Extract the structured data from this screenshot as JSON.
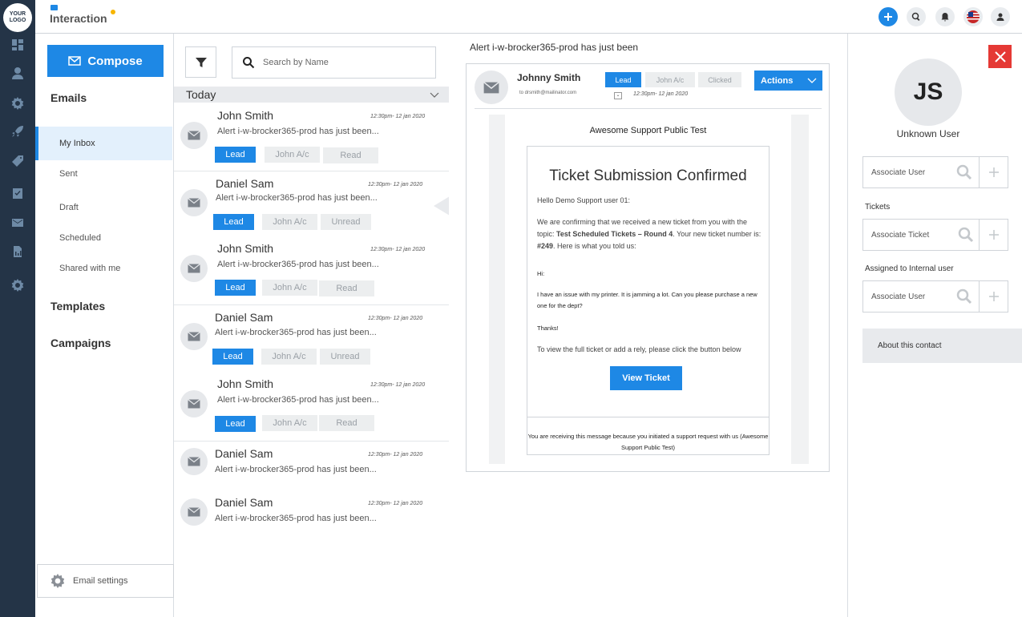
{
  "header": {
    "logo_text": "YOUR LOGO",
    "app_name": "Interaction",
    "icons": [
      "plus-icon",
      "search-icon",
      "bell-icon",
      "us-flag-icon",
      "user-icon"
    ]
  },
  "rail": {
    "icons": [
      "dashboard-icon",
      "contacts-icon",
      "settings-gear-icon",
      "rocket-icon",
      "tag-icon",
      "tasks-icon",
      "mail-icon",
      "reports-icon",
      "cog-icon"
    ]
  },
  "sidebar": {
    "compose_label": "Compose",
    "emails_title": "Emails",
    "folders": [
      {
        "label": "My Inbox"
      },
      {
        "label": "Sent"
      },
      {
        "label": "Draft"
      },
      {
        "label": "Scheduled"
      },
      {
        "label": "Shared with me"
      }
    ],
    "templates_title": "Templates",
    "campaigns_title": "Campaigns",
    "settings_label": "Email settings"
  },
  "list": {
    "search_placeholder": "Search by Name",
    "group_label": "Today",
    "messages": [
      {
        "name": "John Smith",
        "time": "12:30pm-   12 jan 2020",
        "subject": "Alert i-w-brocker365-prod has just been...",
        "tags": [
          "Lead",
          "John A/c",
          "Read"
        ]
      },
      {
        "name": "Daniel Sam",
        "time": "12:30pm-   12 jan 2020",
        "subject": "Alert i-w-brocker365-prod has just been...",
        "tags": [
          "Lead",
          "John A/c",
          "Unread"
        ]
      },
      {
        "name": "John Smith",
        "time": "12:30pm-   12 jan 2020",
        "subject": "Alert i-w-brocker365-prod has just been...",
        "tags": [
          "Lead",
          "John A/c",
          "Read"
        ]
      },
      {
        "name": "Daniel Sam",
        "time": "12:30pm-   12 jan 2020",
        "subject": "Alert i-w-brocker365-prod has just been...",
        "tags": [
          "Lead",
          "John A/c",
          "Unread"
        ]
      },
      {
        "name": "John Smith",
        "time": "12:30pm-   12 jan 2020",
        "subject": "Alert i-w-brocker365-prod has just been...",
        "tags": [
          "Lead",
          "John A/c",
          "Read"
        ]
      },
      {
        "name": "Daniel Sam",
        "time": "12:30pm-   12 jan 2020",
        "subject": "Alert i-w-brocker365-prod has just been..."
      },
      {
        "name": "Daniel Sam",
        "time": "12:30pm-   12 jan 2020",
        "subject": "Alert i-w-brocker365-prod has just been..."
      }
    ]
  },
  "reader": {
    "title": "Alert i-w-brocker365-prod has just been",
    "from_name": "Johnny Smith",
    "to": "to drsmith@mailinator.com",
    "time": "12:30pm-  12 jan 2020",
    "tags": [
      "Lead",
      "John A/c",
      "Clicked"
    ],
    "actions_label": "Actions",
    "email": {
      "brand": "Awesome Support Public Test",
      "heading": "Ticket Submission Confirmed",
      "greeting": "Hello Demo Support user 01:",
      "confirm_prefix": "We are confirming that we received a new ticket from you with the topic:",
      "confirm_topic": "Test Scheduled Tickets – Round 4",
      "confirm_mid": ". Your new ticket number is:",
      "confirm_number": "#249",
      "confirm_suffix": ". Here is what you told us:",
      "hi": "Hi:",
      "issue": "I have an issue with my printer.  It is jamming a lot. Can you please purchase a new one for the dept?",
      "thanks": "Thanks!",
      "instruction": "To view the full ticket or add a rely, please click the button below",
      "button_label": "View Ticket",
      "footer": "You are receiving this message because you initiated a support request with us (Awesome Support Public Test)"
    }
  },
  "contact": {
    "initials": "JS",
    "name": "Unknown User",
    "associate_user_placeholder": "Associate User",
    "tickets_label": "Tickets",
    "associate_ticket_placeholder": "Associate Ticket",
    "assigned_label": "Assigned to Internal user",
    "assigned_user_placeholder": "Associate User",
    "about_label": "About this contact"
  },
  "colors": {
    "accent": "#1e88e5",
    "rail": "#243447",
    "danger": "#e53935"
  }
}
